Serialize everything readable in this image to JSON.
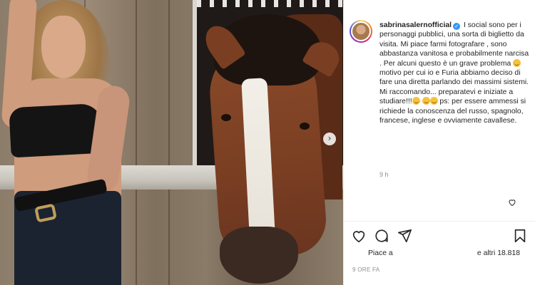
{
  "post": {
    "username": "sabrinasalernofficial",
    "caption_parts": [
      " I social sono per i personaggi pubblici, una sorta di biglietto da visita. Mi piace farmi fotografare , sono abbastanza vanitosa e probabilmente narcisa . Per alcuni questo è un grave problema ",
      " motivo per cui io e Furia abbiamo deciso di fare una diretta parlando dei massimi sistemi. Mi raccomando... preparatevi e iniziate a studiare!!!",
      " ps: per essere ammessi si richiede la conoscenza del russo, spagnolo, francese, inglese e ovviamente cavallese."
    ],
    "time_ago": "9 h",
    "likes_prefix": "Piace a",
    "likes_others": "e altri 18.818",
    "date": "9 ORE FA"
  },
  "icons": {
    "verified": "verified-badge-icon",
    "next": "chevron-right-icon",
    "like": "heart-icon",
    "comment": "comment-bubble-icon",
    "share": "paper-plane-icon",
    "save": "bookmark-icon",
    "emoji": "grinning-face-emoji"
  },
  "colors": {
    "verified": "#3897f0",
    "text": "#262626",
    "muted": "#8e8e8e"
  }
}
